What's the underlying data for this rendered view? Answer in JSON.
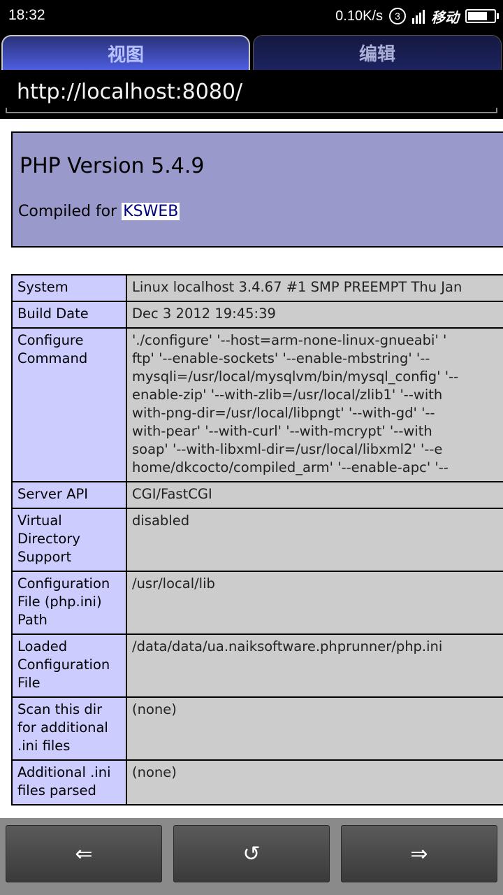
{
  "status_bar": {
    "time": "18:32",
    "network_speed": "0.10K/s",
    "sim_number": "3",
    "carrier": "移动",
    "battery_level": 0.85
  },
  "tabs": [
    {
      "label": "视图",
      "active": true
    },
    {
      "label": "编辑",
      "active": false
    }
  ],
  "address_bar": {
    "url": "http://localhost:8080/"
  },
  "page": {
    "title": "PHP Version 5.4.9",
    "compiled_prefix": "Compiled for ",
    "compiled_link": "KSWEB",
    "rows": [
      {
        "label": "System",
        "value": "Linux localhost 3.4.67 #1 SMP PREEMPT Thu Jan"
      },
      {
        "label": "Build Date",
        "value": "Dec 3 2012 19:45:39"
      },
      {
        "label": "Configure Command",
        "lines": [
          "'./configure' '--host=arm-none-linux-gnueabi' '",
          "ftp' '--enable-sockets' '--enable-mbstring' '--",
          "mysqli=/usr/local/mysqlvm/bin/mysql_config' '--",
          "enable-zip' '--with-zlib=/usr/local/zlib1' '--with",
          "with-png-dir=/usr/local/libpngt' '--with-gd' '--",
          "with-pear' '--with-curl' '--with-mcrypt' '--with",
          "soap' '--with-libxml-dir=/usr/local/libxml2' '--e",
          "home/dkcocto/compiled_arm' '--enable-apc' '--"
        ]
      },
      {
        "label": "Server API",
        "value": "CGI/FastCGI"
      },
      {
        "label": "Virtual Directory Support",
        "value": "disabled"
      },
      {
        "label": "Configuration File (php.ini) Path",
        "value": "/usr/local/lib"
      },
      {
        "label": "Loaded Configuration File",
        "value": "/data/data/ua.naiksoftware.phprunner/php.ini"
      },
      {
        "label": "Scan this dir for additional .ini files",
        "value": "(none)"
      },
      {
        "label": "Additional .ini files parsed",
        "value": "(none)"
      }
    ]
  },
  "nav": {
    "back": "⇐",
    "reload": "↺",
    "forward": "⇒"
  },
  "colors": {
    "header_bg": "#9999cc",
    "label_bg": "#ccccff",
    "value_bg": "#cccccc",
    "link": "#000080"
  }
}
